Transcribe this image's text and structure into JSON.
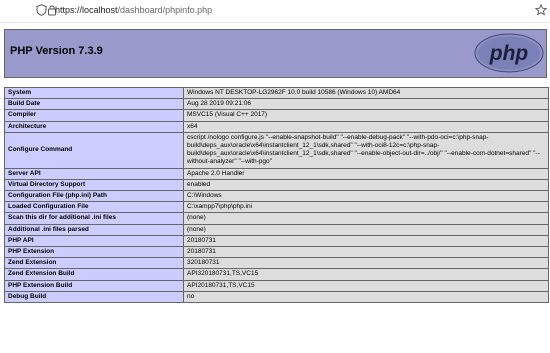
{
  "browser": {
    "url_host": "https://localhost",
    "url_path": "/dashboard/phpinfo.php"
  },
  "header": {
    "title": "PHP Version 7.3.9",
    "logo_text": "php"
  },
  "rows": [
    {
      "label": "System",
      "value": "Windows NT DESKTOP-LG2962F 10.0 build 10586 (Windows 10) AMD64"
    },
    {
      "label": "Build Date",
      "value": "Aug 28 2019 09:21:06"
    },
    {
      "label": "Compiler",
      "value": "MSVC15 (Visual C++ 2017)"
    },
    {
      "label": "Architecture",
      "value": "x64"
    },
    {
      "label": "Configure Command",
      "value": "cscript /nologo configure.js \"--enable-snapshot-build\" \"--enable-debug-pack\" \"--with-pdo-oci=c:\\php-snap-build\\deps_aux\\oracle\\x64\\instantclient_12_1\\sdk,shared\" \"--with-oci8-12c=c:\\php-snap-build\\deps_aux\\oracle\\x64\\instantclient_12_1\\sdk,shared\" \"--enable-object-out-dir=../obj/\" \"--enable-com-dotnet=shared\" \"--without-analyzer\" \"--with-pgo\""
    },
    {
      "label": "Server API",
      "value": "Apache 2.0 Handler"
    },
    {
      "label": "Virtual Directory Support",
      "value": "enabled"
    },
    {
      "label": "Configuration File (php.ini) Path",
      "value": "C:\\Windows"
    },
    {
      "label": "Loaded Configuration File",
      "value": "C:\\xampp7\\php\\php.ini"
    },
    {
      "label": "Scan this dir for additional .ini files",
      "value": "(none)"
    },
    {
      "label": "Additional .ini files parsed",
      "value": "(none)"
    },
    {
      "label": "PHP API",
      "value": "20180731"
    },
    {
      "label": "PHP Extension",
      "value": "20180731"
    },
    {
      "label": "Zend Extension",
      "value": "320180731"
    },
    {
      "label": "Zend Extension Build",
      "value": "API320180731,TS,VC15"
    },
    {
      "label": "PHP Extension Build",
      "value": "API20180731,TS,VC15"
    },
    {
      "label": "Debug Build",
      "value": "no"
    }
  ]
}
